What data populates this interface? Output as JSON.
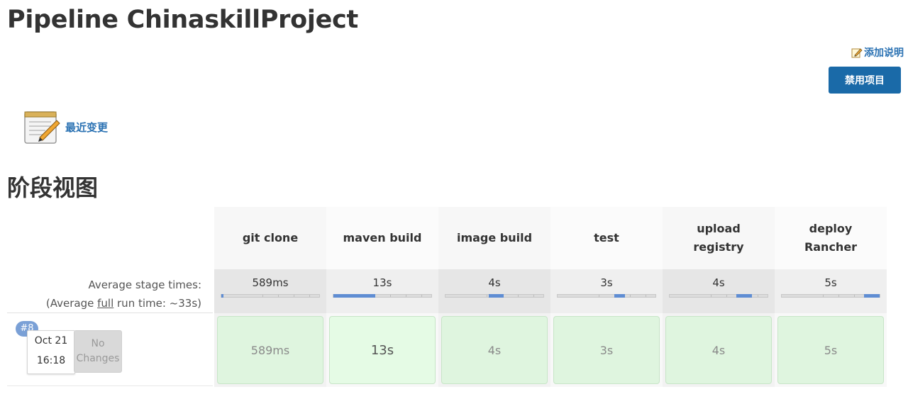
{
  "page": {
    "title": "Pipeline ChinaskillProject"
  },
  "actions": {
    "add_description": "添加说明",
    "disable_project": "禁用项目",
    "recent_changes": "最近变更"
  },
  "stage_view": {
    "heading": "阶段视图",
    "avg_label_line1": "Average stage times:",
    "avg_label_prefix": "(Average ",
    "avg_label_link": "full",
    "avg_label_suffix": " run time: ~33s)",
    "stages": [
      {
        "name_line1": "git clone",
        "name_line2": "",
        "avg": "589ms",
        "run": "589ms",
        "fill_start": 0.0,
        "fill_end": 0.02
      },
      {
        "name_line1": "maven build",
        "name_line2": "",
        "avg": "13s",
        "run": "13s",
        "fill_start": 0.0,
        "fill_end": 0.43
      },
      {
        "name_line1": "image build",
        "name_line2": "",
        "avg": "4s",
        "run": "4s",
        "fill_start": 0.44,
        "fill_end": 0.59
      },
      {
        "name_line1": "test",
        "name_line2": "",
        "avg": "3s",
        "run": "3s",
        "fill_start": 0.58,
        "fill_end": 0.69
      },
      {
        "name_line1": "upload",
        "name_line2": "registry",
        "avg": "4s",
        "run": "4s",
        "fill_start": 0.68,
        "fill_end": 0.84
      },
      {
        "name_line1": "deploy",
        "name_line2": "Rancher",
        "avg": "5s",
        "run": "5s",
        "fill_start": 0.84,
        "fill_end": 1.0
      }
    ]
  },
  "build": {
    "number": "#8",
    "date": "Oct 21",
    "time": "16:18",
    "changes_line1": "No",
    "changes_line2": "Changes"
  },
  "colors": {
    "link": "#2b72b3",
    "button": "#1a6aa8",
    "success_fill": "#dff5df",
    "bar_fill": "#5f8dd3"
  }
}
